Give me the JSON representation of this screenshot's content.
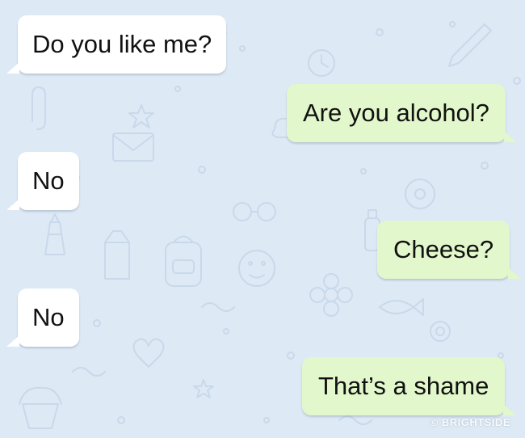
{
  "chat": {
    "background_color": "#dde9f5",
    "incoming_color": "#ffffff",
    "outgoing_color": "#e2f7cb",
    "messages": [
      {
        "direction": "incoming",
        "text": "Do you like me?"
      },
      {
        "direction": "outgoing",
        "text": "Are you alcohol?"
      },
      {
        "direction": "incoming",
        "text": "No"
      },
      {
        "direction": "outgoing",
        "text": "Cheese?"
      },
      {
        "direction": "incoming",
        "text": "No"
      },
      {
        "direction": "outgoing",
        "text": "That’s a shame"
      }
    ]
  },
  "watermark": {
    "text": "© BRIGHTSIDE"
  }
}
